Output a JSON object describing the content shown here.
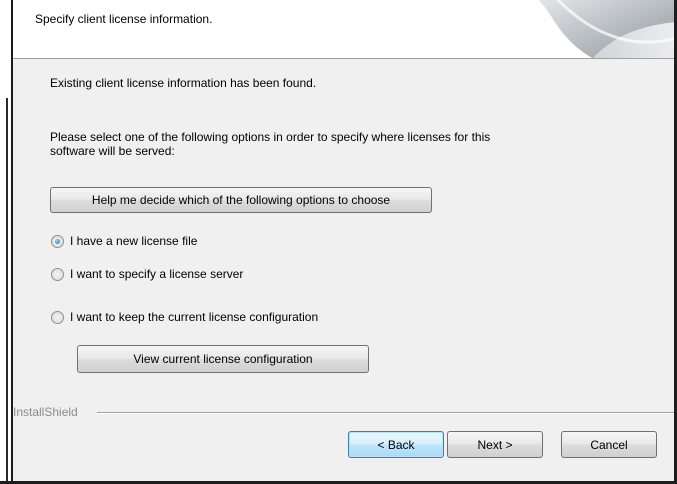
{
  "header": {
    "description": "Specify client license information."
  },
  "body": {
    "found_text": "Existing client license information has been found.",
    "instruction_line1": "Please select one of the following options in order to specify where licenses for this",
    "instruction_line2": "software will be served:",
    "help_button": "Help me decide which of the following options to choose",
    "options": [
      {
        "label": "I have a new license file",
        "selected": true
      },
      {
        "label": "I want to specify a license server",
        "selected": false
      },
      {
        "label": "I want to keep the current license configuration",
        "selected": false
      }
    ],
    "view_button": "View current license configuration"
  },
  "footer": {
    "brand": "InstallShield",
    "back": "< Back",
    "next": "Next >",
    "cancel": "Cancel"
  },
  "colors": {
    "dialog_bg": "#f0f0f0",
    "header_bg": "#ffffff",
    "selected_radio": "#1b6fc4"
  },
  "icons": {
    "header_graphic": "setup-banner-swoosh-icon"
  }
}
